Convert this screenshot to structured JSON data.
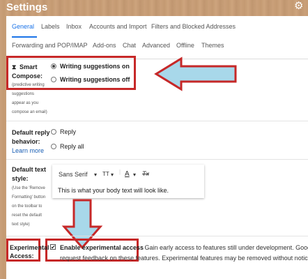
{
  "app": {
    "title": "Settings"
  },
  "tabs": {
    "row1": [
      "General",
      "Labels",
      "Inbox",
      "Accounts and Import",
      "Filters and Blocked Addresses"
    ],
    "row2": [
      "Forwarding and POP/IMAP",
      "Add-ons",
      "Chat",
      "Advanced",
      "Offline",
      "Themes"
    ],
    "active": "General"
  },
  "smart_compose": {
    "label_line1": "Smart",
    "label_line2": "Compose:",
    "sub": [
      "(predictive writing",
      "suggestions",
      "appear as you",
      "compose an email)"
    ],
    "option_on": "Writing suggestions on",
    "option_off": "Writing suggestions off",
    "selected": "on"
  },
  "default_reply": {
    "label_line1": "Default reply",
    "label_line2": "behavior:",
    "learn_more": "Learn more",
    "option_reply": "Reply",
    "option_reply_all": "Reply all"
  },
  "default_text": {
    "label_line1": "Default text",
    "label_line2": "style:",
    "sub": [
      "(Use the 'Remove",
      "Formatting' button",
      "on the toolbar to",
      "reset the default",
      "text style)"
    ],
    "font": "Sans Serif",
    "size_icon": "TT",
    "color_icon": "A",
    "clear_icon": "Tx",
    "sample_text": "This is what your body text will look like."
  },
  "experimental": {
    "label_line1": "Experimental",
    "label_line2": "Access:",
    "checkbox_checked": true,
    "option_title": "Enable experimental access",
    "desc_line1": "- Gain early access to features still under development. Google",
    "desc_line2": "request feedback on these features. Experimental features may be removed without notice."
  },
  "colors": {
    "accent": "#1a73e8",
    "highlight": "#c62828",
    "arrow": "#a8d8ea"
  }
}
